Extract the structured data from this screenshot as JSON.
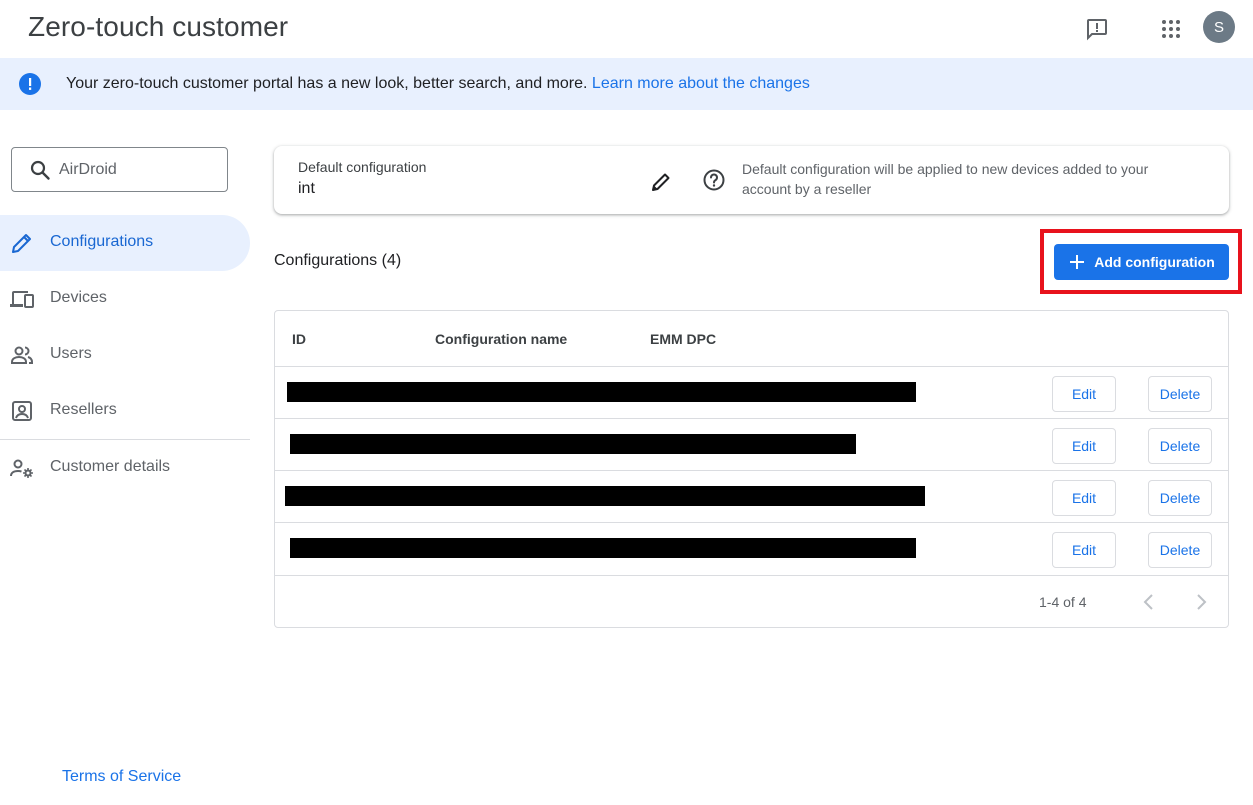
{
  "header": {
    "title": "Zero-touch customer",
    "avatar_initial": "S"
  },
  "banner": {
    "text": "Your zero-touch customer portal has a new look, better search, and more.",
    "link": "Learn more about the changes"
  },
  "sidebar": {
    "search_value": "AirDroid",
    "items": [
      {
        "label": "Configurations",
        "icon": "pencil-icon",
        "active": true
      },
      {
        "label": "Devices",
        "icon": "devices-icon",
        "active": false
      },
      {
        "label": "Users",
        "icon": "users-icon",
        "active": false
      },
      {
        "label": "Resellers",
        "icon": "reseller-icon",
        "active": false
      },
      {
        "label": "Customer details",
        "icon": "customer-settings-icon",
        "active": false
      }
    ],
    "footer_link": "Terms of Service"
  },
  "default_config": {
    "label": "Default configuration",
    "value": "int",
    "note": "Default configuration will be applied to new devices added to your account by a reseller"
  },
  "configurations": {
    "heading": "Configurations (4)",
    "add_button": "Add configuration",
    "columns": [
      "ID",
      "Configuration name",
      "EMM DPC"
    ],
    "row_actions": {
      "edit": "Edit",
      "delete": "Delete"
    },
    "row_count": 4,
    "pagination": "1-4 of 4"
  },
  "colors": {
    "primary": "#1a73e8",
    "highlight": "#e8121c",
    "banner_bg": "#e8f0fe"
  }
}
